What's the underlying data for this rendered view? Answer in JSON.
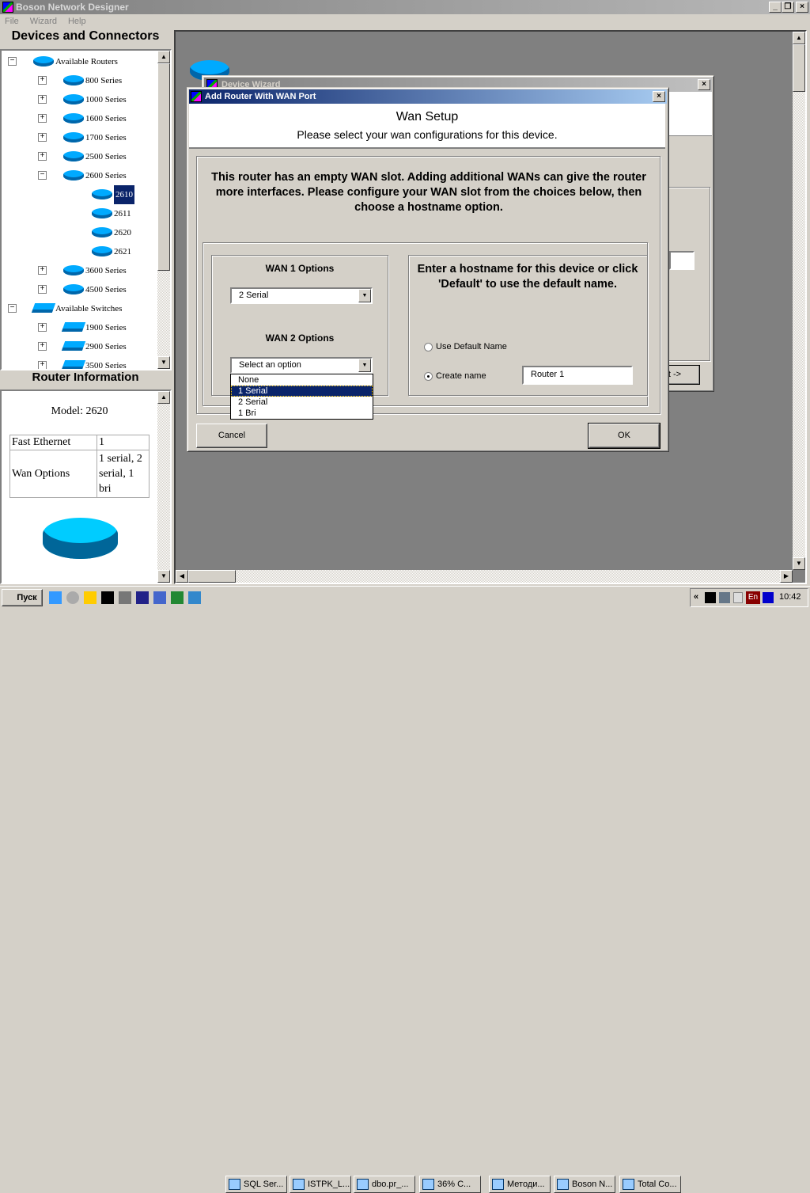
{
  "app": {
    "title": "Boson Network Designer",
    "menu": [
      "File",
      "Wizard",
      "Help"
    ]
  },
  "left": {
    "devices_heading": "Devices and Connectors",
    "tree": [
      {
        "label": "Available Routers",
        "level": 0,
        "exp": "-",
        "icon": "router"
      },
      {
        "label": "800 Series",
        "level": 1,
        "exp": "+",
        "icon": "router"
      },
      {
        "label": "1000 Series",
        "level": 1,
        "exp": "+",
        "icon": "router"
      },
      {
        "label": "1600 Series",
        "level": 1,
        "exp": "+",
        "icon": "router"
      },
      {
        "label": "1700 Series",
        "level": 1,
        "exp": "+",
        "icon": "router"
      },
      {
        "label": "2500 Series",
        "level": 1,
        "exp": "+",
        "icon": "router"
      },
      {
        "label": "2600 Series",
        "level": 1,
        "exp": "-",
        "icon": "router"
      },
      {
        "label": "2610",
        "level": 2,
        "exp": "",
        "icon": "router",
        "selected": true
      },
      {
        "label": "2611",
        "level": 2,
        "exp": "",
        "icon": "router"
      },
      {
        "label": "2620",
        "level": 2,
        "exp": "",
        "icon": "router"
      },
      {
        "label": "2621",
        "level": 2,
        "exp": "",
        "icon": "router"
      },
      {
        "label": "3600 Series",
        "level": 1,
        "exp": "+",
        "icon": "router"
      },
      {
        "label": "4500 Series",
        "level": 1,
        "exp": "+",
        "icon": "router"
      },
      {
        "label": "Available Switches",
        "level": 0,
        "exp": "-",
        "icon": "switch"
      },
      {
        "label": "1900 Series",
        "level": 1,
        "exp": "+",
        "icon": "switch"
      },
      {
        "label": "2900 Series",
        "level": 1,
        "exp": "+",
        "icon": "switch"
      },
      {
        "label": "3500 Series",
        "level": 1,
        "exp": "+",
        "icon": "switch"
      }
    ],
    "info_heading": "Router Information",
    "model": "Model: 2620",
    "table": [
      {
        "k": "Fast Ethernet",
        "v": "1"
      },
      {
        "k": "Wan Options",
        "v": "1 serial, 2 serial, 1 bri"
      }
    ]
  },
  "bg_wizard": {
    "title": "Device Wizard",
    "next_label": "t ->"
  },
  "dialog": {
    "title": "Add Router With WAN Port",
    "heading": "Wan Setup",
    "subheading": "Please select your wan configurations for this device.",
    "intro": "This router has an empty WAN slot. Adding additional WANs can give the router more interfaces. Please configure your WAN slot from the choices below, then choose a hostname option.",
    "wan1_label": "WAN 1 Options",
    "wan1_value": "2 Serial",
    "wan2_label": "WAN 2 Options",
    "wan2_value": "Select an option",
    "wan2_options": [
      "None",
      "1 Serial",
      "2 Serial",
      "1 Bri"
    ],
    "wan2_highlighted": "1 Serial",
    "hostname_prompt": "Enter a hostname for this device or click 'Default' to use the default name.",
    "radio_default": "Use Default Name",
    "radio_create": "Create name",
    "hostname_value": "Router 1",
    "cancel": "Cancel",
    "ok": "OK"
  },
  "taskbar": {
    "start": "Пуск",
    "tasks": [
      "SQL Ser...",
      "ISTPK_L...",
      "dbo.pr_...",
      "36% C...",
      "Методи...",
      "Boson N...",
      "Total Co..."
    ],
    "lang": "En",
    "clock": "10:42"
  }
}
